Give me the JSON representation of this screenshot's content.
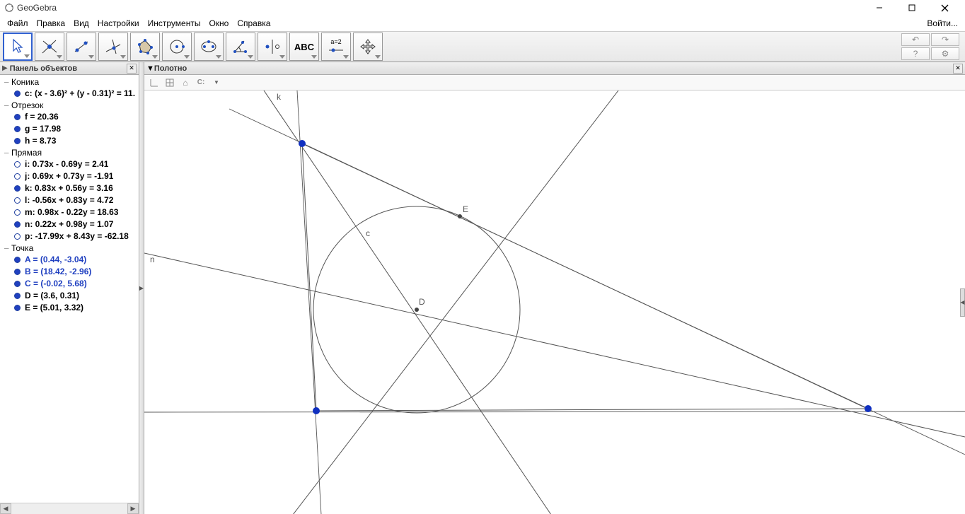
{
  "title": "GeoGebra",
  "menu": {
    "file": "Файл",
    "edit": "Правка",
    "view": "Вид",
    "settings": "Настройки",
    "tools": "Инструменты",
    "window": "Окно",
    "help": "Справка",
    "login": "Войти..."
  },
  "panels": {
    "objects_title": "Панель объектов",
    "canvas_title": "Полотно"
  },
  "groups": {
    "conic": "Коника",
    "segment": "Отрезок",
    "line": "Прямая",
    "point": "Точка"
  },
  "objects": {
    "c": "c: (x - 3.6)² + (y - 0.31)² = 11.",
    "f": "f = 20.36",
    "g": "g = 17.98",
    "h": "h = 8.73",
    "i": "i: 0.73x - 0.69y = 2.41",
    "j": "j: 0.69x + 0.73y = -1.91",
    "k": "k: 0.83x + 0.56y = 3.16",
    "l": "l: -0.56x + 0.83y = 4.72",
    "m": "m: 0.98x - 0.22y = 18.63",
    "n": "n: 0.22x + 0.98y = 1.07",
    "p": "p: -17.99x + 8.43y = -62.18",
    "A": "A = (0.44, -3.04)",
    "B": "B = (18.42, -2.96)",
    "C": "C = (-0.02, 5.68)",
    "D": "D = (3.6, 0.31)",
    "E": "E = (5.01, 3.32)"
  },
  "canvas_labels": {
    "k": "k",
    "n": "n",
    "c": "c",
    "D": "D",
    "E": "E"
  },
  "icons": {
    "text": "ABC",
    "slider": "a=2"
  }
}
